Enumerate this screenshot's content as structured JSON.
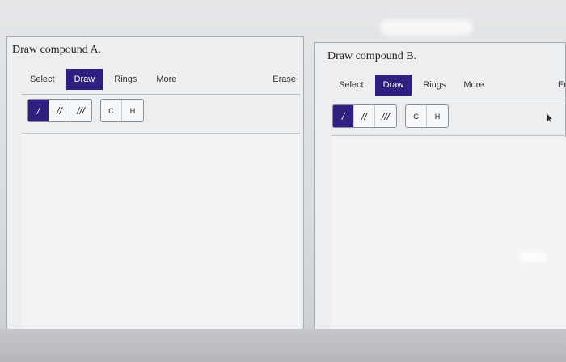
{
  "panel_a": {
    "title": "Draw compound A.",
    "toolbar": {
      "select": "Select",
      "draw": "Draw",
      "rings": "Rings",
      "more": "More",
      "erase": "Erase"
    },
    "bonds": {
      "single": "/",
      "double": "//",
      "triple": "///"
    },
    "atoms": {
      "carbon": "C",
      "hydrogen": "H"
    }
  },
  "panel_b": {
    "title": "Draw compound B.",
    "toolbar": {
      "select": "Select",
      "draw": "Draw",
      "rings": "Rings",
      "more": "More",
      "erase": "Er"
    },
    "bonds": {
      "single": "/",
      "double": "//",
      "triple": "///"
    },
    "atoms": {
      "carbon": "C",
      "hydrogen": "H"
    }
  },
  "colors": {
    "accent": "#2f1f7e"
  }
}
